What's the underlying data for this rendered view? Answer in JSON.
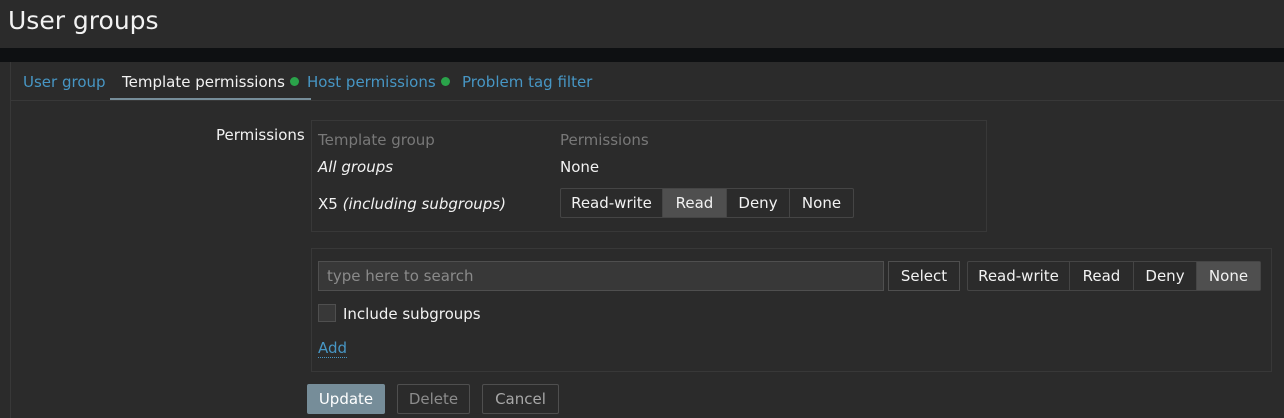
{
  "page": {
    "title": "User groups"
  },
  "tabs": [
    {
      "label": "User group"
    },
    {
      "label": "Template permissions"
    },
    {
      "label": "Host permissions"
    },
    {
      "label": "Problem tag filter"
    }
  ],
  "permissions": {
    "label": "Permissions",
    "headers": {
      "group": "Template group",
      "permissions": "Permissions"
    },
    "rows": [
      {
        "group": "All groups",
        "value": "None"
      },
      {
        "group": "X5",
        "suffix": "(including subgroups)"
      }
    ],
    "options": [
      "Read-write",
      "Read",
      "Deny",
      "None"
    ],
    "row_selected": "Read"
  },
  "add_form": {
    "search_placeholder": "type here to search",
    "select_label": "Select",
    "options": [
      "Read-write",
      "Read",
      "Deny",
      "None"
    ],
    "selected": "None",
    "include_subgroups_label": "Include subgroups",
    "add_label": "Add"
  },
  "actions": {
    "update": "Update",
    "delete": "Delete",
    "cancel": "Cancel"
  },
  "colors": {
    "link": "#4796c4",
    "status_dot": "#2aa34a",
    "primary_button": "#768d99"
  }
}
